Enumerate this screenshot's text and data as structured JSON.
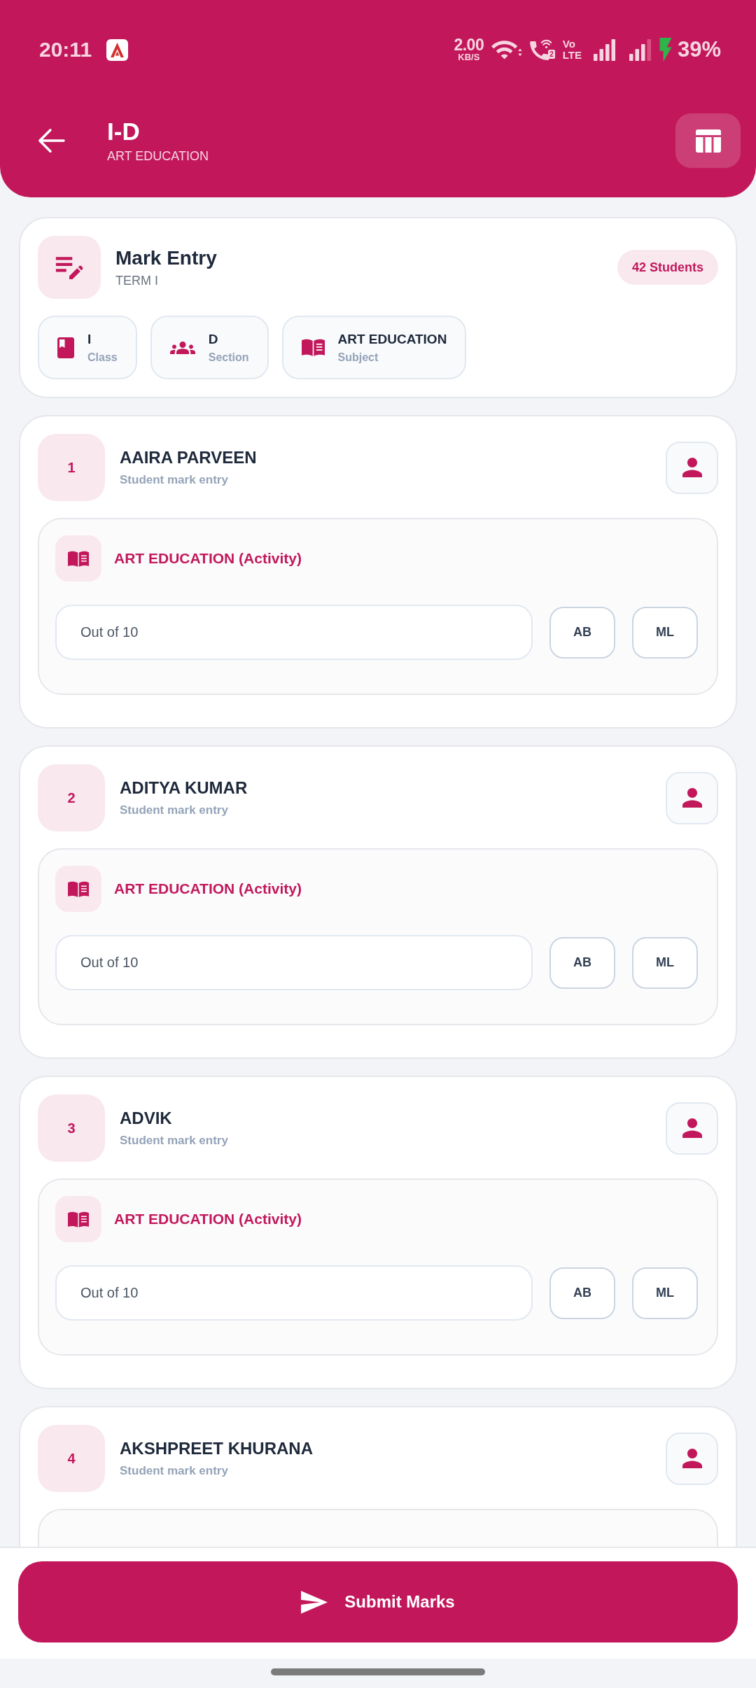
{
  "status_bar": {
    "time": "20:11",
    "net_speed": "2.00",
    "net_speed_unit": "KB/S",
    "wifi_call_sim": "2",
    "volte_top": "Vo",
    "volte_bottom": "LTE",
    "battery": "39%"
  },
  "header": {
    "title": "I-D",
    "subtitle": "ART EDUCATION"
  },
  "summary": {
    "title": "Mark Entry",
    "term": "TERM I",
    "count_badge": "42 Students",
    "chips": [
      {
        "kind": "class",
        "value": "I",
        "label": "Class"
      },
      {
        "kind": "section",
        "value": "D",
        "label": "Section"
      },
      {
        "kind": "subject",
        "value": "ART EDUCATION",
        "label": "Subject"
      }
    ]
  },
  "students": [
    {
      "number": "1",
      "name": "AAIRA PARVEEN",
      "subtitle": "Student mark entry",
      "subject": "ART EDUCATION (Activity)",
      "placeholder": "Out of 10",
      "buttons": [
        "AB",
        "ML"
      ]
    },
    {
      "number": "2",
      "name": "ADITYA KUMAR",
      "subtitle": "Student mark entry",
      "subject": "ART EDUCATION (Activity)",
      "placeholder": "Out of 10",
      "buttons": [
        "AB",
        "ML"
      ]
    },
    {
      "number": "3",
      "name": "ADVIK",
      "subtitle": "Student mark entry",
      "subject": "ART EDUCATION (Activity)",
      "placeholder": "Out of 10",
      "buttons": [
        "AB",
        "ML"
      ]
    },
    {
      "number": "4",
      "name": "AKSHPREET KHURANA",
      "subtitle": "Student mark entry"
    }
  ],
  "submit_button": "Submit Marks"
}
